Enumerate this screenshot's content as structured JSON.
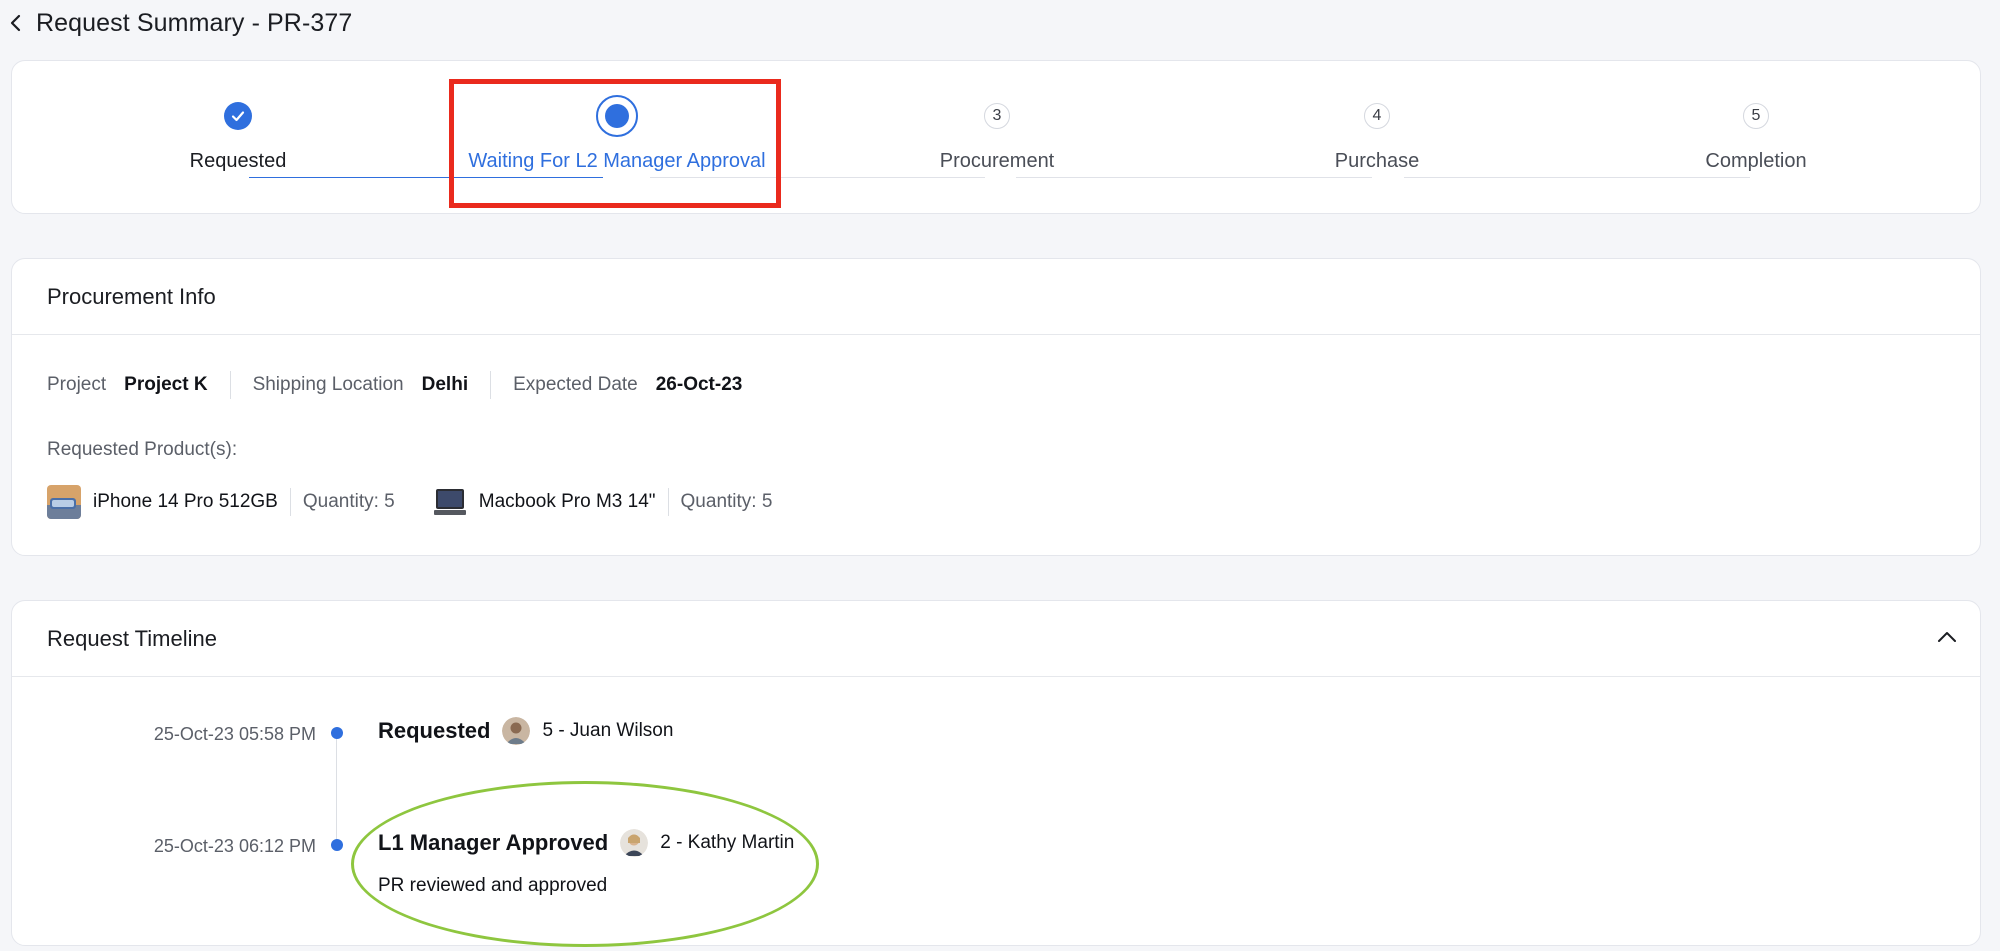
{
  "header": {
    "back_icon": "chevron-left-icon",
    "title": "Request Summary - PR-377"
  },
  "stepper": {
    "steps": [
      {
        "label": "Requested",
        "status": "done",
        "number": ""
      },
      {
        "label": "Waiting For L2 Manager Approval",
        "status": "current",
        "number": ""
      },
      {
        "label": "Procurement",
        "status": "todo",
        "number": "3"
      },
      {
        "label": "Purchase",
        "status": "todo",
        "number": "4"
      },
      {
        "label": "Completion",
        "status": "todo",
        "number": "5"
      }
    ],
    "accent_color": "#2f6fde"
  },
  "procurement": {
    "title": "Procurement Info",
    "fields": [
      {
        "key": "Project",
        "value": "Project K"
      },
      {
        "key": "Shipping Location",
        "value": "Delhi"
      },
      {
        "key": "Expected Date",
        "value": "26-Oct-23"
      }
    ],
    "requested_label": "Requested Product(s):",
    "products": [
      {
        "name": "iPhone 14 Pro 512GB",
        "quantity": "Quantity: 5"
      },
      {
        "name": "Macbook Pro M3 14\"",
        "quantity": "Quantity: 5"
      }
    ]
  },
  "timeline": {
    "title": "Request Timeline",
    "collapse_icon": "chevron-up-icon",
    "events": [
      {
        "time": "25-Oct-23 05:58 PM",
        "title": "Requested",
        "user": "5 - Juan Wilson",
        "comment": ""
      },
      {
        "time": "25-Oct-23 06:12 PM",
        "title": "L1 Manager Approved",
        "user": "2 - Kathy Martin",
        "comment": "PR reviewed and approved"
      }
    ]
  },
  "annotations": {
    "highlight_box_color": "#ea2a1d",
    "ellipse_color": "#8ec63f"
  }
}
